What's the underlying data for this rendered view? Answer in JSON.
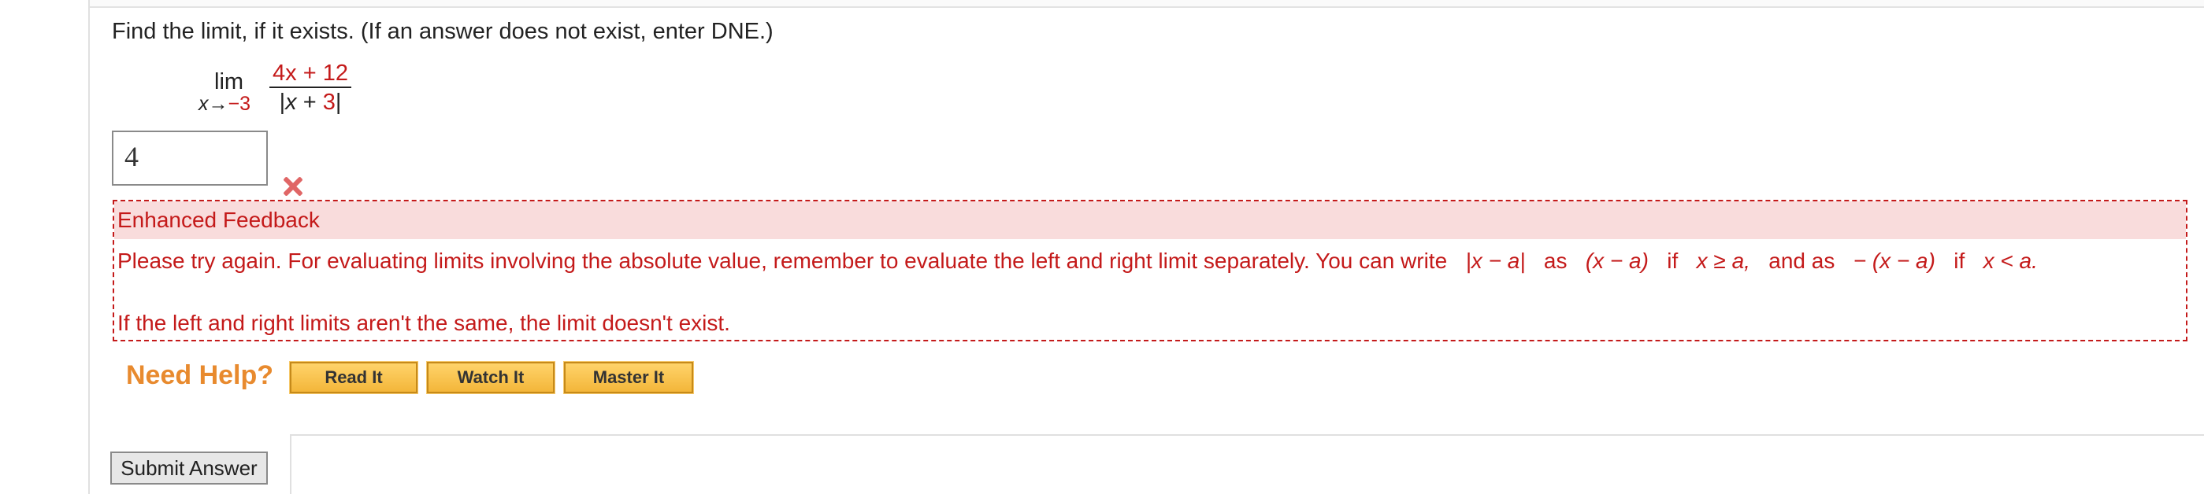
{
  "question": {
    "text": "Find the limit, if it exists. (If an answer does not exist, enter DNE.)"
  },
  "limit": {
    "word": "lim",
    "var": "x",
    "arrow": "→",
    "approach": "−3",
    "numerator": {
      "var": "4x",
      "op": "+",
      "const": "12"
    },
    "denominator": {
      "open": "|",
      "var": "x",
      "op": "+",
      "const": "3",
      "close": "|"
    }
  },
  "answer": {
    "value": "4",
    "status": "incorrect",
    "status_icon": "x-mark-icon"
  },
  "feedback": {
    "heading": "Enhanced Feedback",
    "line1_text": "Please try again. For evaluating limits involving the absolute value, remember to evaluate the left and right limit separately. You can write",
    "abs_expr": "|x − a|",
    "as1": "as",
    "case1_expr": "(x − a)",
    "if1": "if",
    "cond1": "x ≥ a,",
    "and_as": "and as",
    "case2_expr": "− (x − a)",
    "if2": "if",
    "cond2": "x < a.",
    "line2": "If the left and right limits aren't the same, the limit doesn't exist."
  },
  "help": {
    "label": "Need Help?",
    "buttons": [
      "Read It",
      "Watch It",
      "Master It"
    ]
  },
  "submit": {
    "label": "Submit Answer"
  },
  "colors": {
    "feedback_red": "#c41a1a",
    "feedback_bg": "#f9dcdc",
    "need_help_orange": "#e88a2e",
    "help_button_gold": "#f3b63a"
  }
}
